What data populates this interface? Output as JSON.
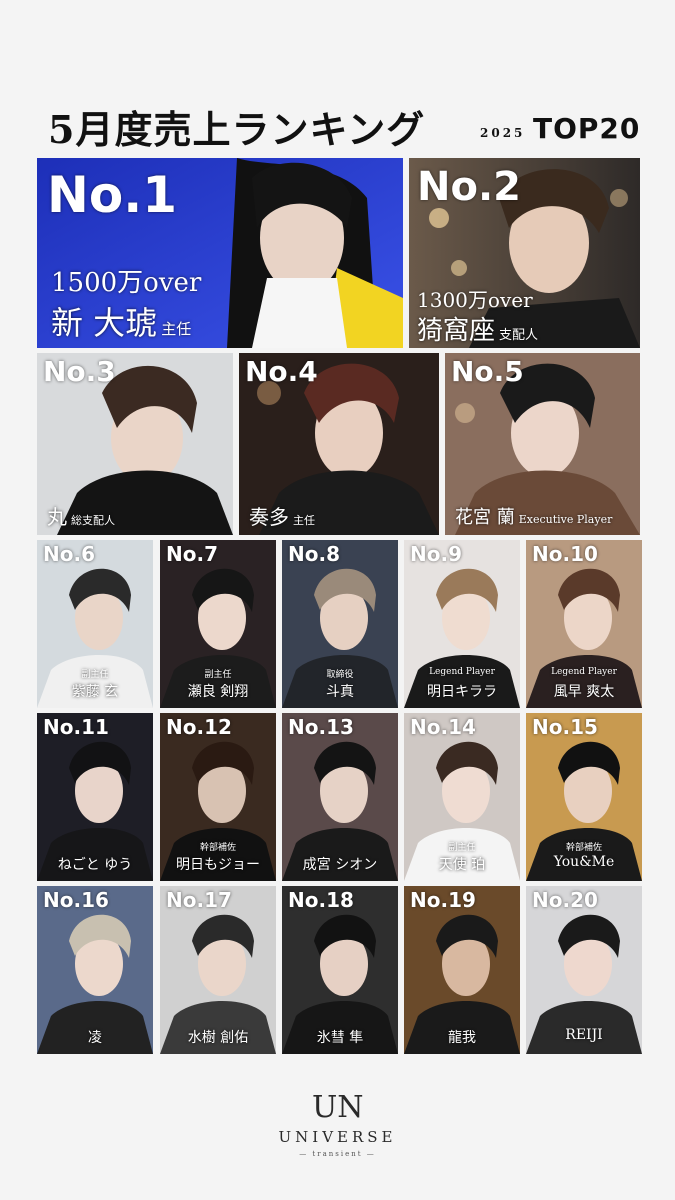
{
  "header": {
    "title": "5月度売上ランキング",
    "year": "2025",
    "top": "TOP20"
  },
  "ranks": [
    {
      "rank": "No.1",
      "sales": "1500万over",
      "name": "新 大琥",
      "title": "主任"
    },
    {
      "rank": "No.2",
      "sales": "1300万over",
      "name": "猗窩座",
      "title": "支配人"
    },
    {
      "rank": "No.3",
      "name": "丸",
      "title": "総支配人"
    },
    {
      "rank": "No.4",
      "name": "奏多",
      "title": "主任"
    },
    {
      "rank": "No.5",
      "name": "花宮 蘭",
      "title": "Executive Player"
    },
    {
      "rank": "No.6",
      "role": "副主任",
      "name": "紫藤 玄"
    },
    {
      "rank": "No.7",
      "role": "副主任",
      "name": "瀬良 剣翔"
    },
    {
      "rank": "No.8",
      "role": "取締役",
      "name": "斗真"
    },
    {
      "rank": "No.9",
      "role": "Legend Player",
      "name": "明日キララ"
    },
    {
      "rank": "No.10",
      "role": "Legend Player",
      "name": "風早 爽太"
    },
    {
      "rank": "No.11",
      "role": "",
      "name": "ねごと ゆう"
    },
    {
      "rank": "No.12",
      "role": "幹部補佐",
      "name": "明日もジョー"
    },
    {
      "rank": "No.13",
      "role": "",
      "name": "成宮 シオン"
    },
    {
      "rank": "No.14",
      "role": "副主任",
      "name": "天使 珀"
    },
    {
      "rank": "No.15",
      "role": "幹部補佐",
      "name": "You&Me"
    },
    {
      "rank": "No.16",
      "role": "",
      "name": "凌"
    },
    {
      "rank": "No.17",
      "role": "",
      "name": "水樹 創佑"
    },
    {
      "rank": "No.18",
      "role": "",
      "name": "氷彗 隼"
    },
    {
      "rank": "No.19",
      "role": "",
      "name": "龍我"
    },
    {
      "rank": "No.20",
      "role": "",
      "name": "REIJI"
    }
  ],
  "logo": {
    "mark": "UN",
    "name": "UNIVERSE",
    "sub": "— transient —"
  },
  "colors": {
    "background": "#f4f4f4",
    "no1_bg": "#2b3fd6",
    "text_light": "#ffffff"
  }
}
